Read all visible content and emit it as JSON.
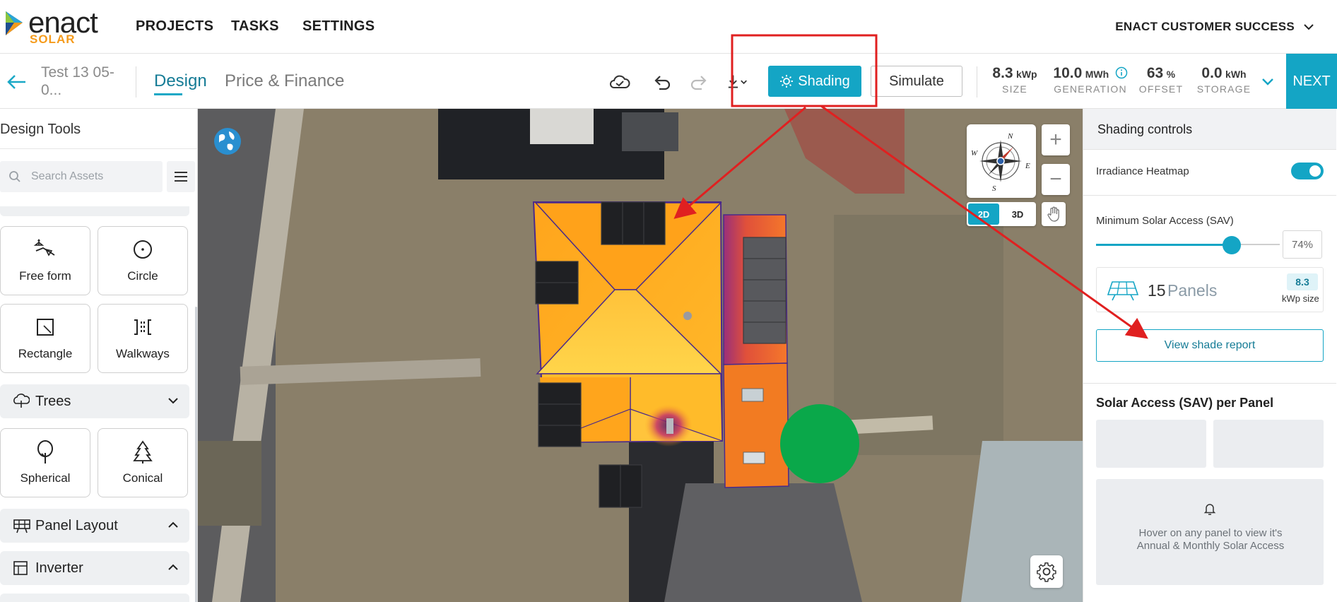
{
  "brand": {
    "name": "enact",
    "sub": "SOLAR"
  },
  "topnav": {
    "items": [
      "PROJECTS",
      "TASKS",
      "SETTINGS"
    ],
    "account": "ENACT CUSTOMER SUCCESS"
  },
  "project": {
    "name": "Test 13 05-0...",
    "tabs": {
      "design": "Design",
      "price": "Price & Finance"
    },
    "shading_label": "Shading",
    "simulate_label": "Simulate",
    "next_label": "NEXT",
    "stats": [
      {
        "value": "8.3",
        "unit": "kWp",
        "label": "SIZE"
      },
      {
        "value": "10.0",
        "unit": "MWh",
        "label": "GENERATION"
      },
      {
        "value": "63",
        "unit": "%",
        "label": "OFFSET"
      },
      {
        "value": "0.0",
        "unit": "kWh",
        "label": "STORAGE"
      }
    ]
  },
  "left_panel": {
    "title": "Design Tools",
    "search_placeholder": "Search Assets",
    "tiles": {
      "free_form": "Free form",
      "circle": "Circle",
      "rectangle": "Rectangle",
      "walkways": "Walkways",
      "spherical": "Spherical",
      "conical": "Conical"
    },
    "sections": {
      "trees": "Trees",
      "panel_layout": "Panel Layout",
      "inverter": "Inverter"
    }
  },
  "map": {
    "compass": {
      "n": "N",
      "e": "E",
      "s": "S",
      "w": "W"
    },
    "zoom_in": "+",
    "zoom_out": "−",
    "view_2d": "2D",
    "view_3d": "3D"
  },
  "right_panel": {
    "title": "Shading controls",
    "irradiance_label": "Irradiance Heatmap",
    "irradiance_on": true,
    "sav_label": "Minimum Solar Access (SAV)",
    "sav_value": "74%",
    "sav_level": 0.74,
    "panels_count": "15",
    "panels_label": "Panels",
    "size_badge": "8.3",
    "size_unit": "kWp size",
    "report_button": "View shade report",
    "per_panel_title": "Solar Access (SAV) per Panel",
    "hover_message": "Hover on any panel to view it's Annual & Monthly Solar Access"
  },
  "colors": {
    "accent": "#14a5c5",
    "brand_orange": "#f59b1c",
    "annotation_red": "#e02020",
    "marker_green": "#0aa84a"
  }
}
